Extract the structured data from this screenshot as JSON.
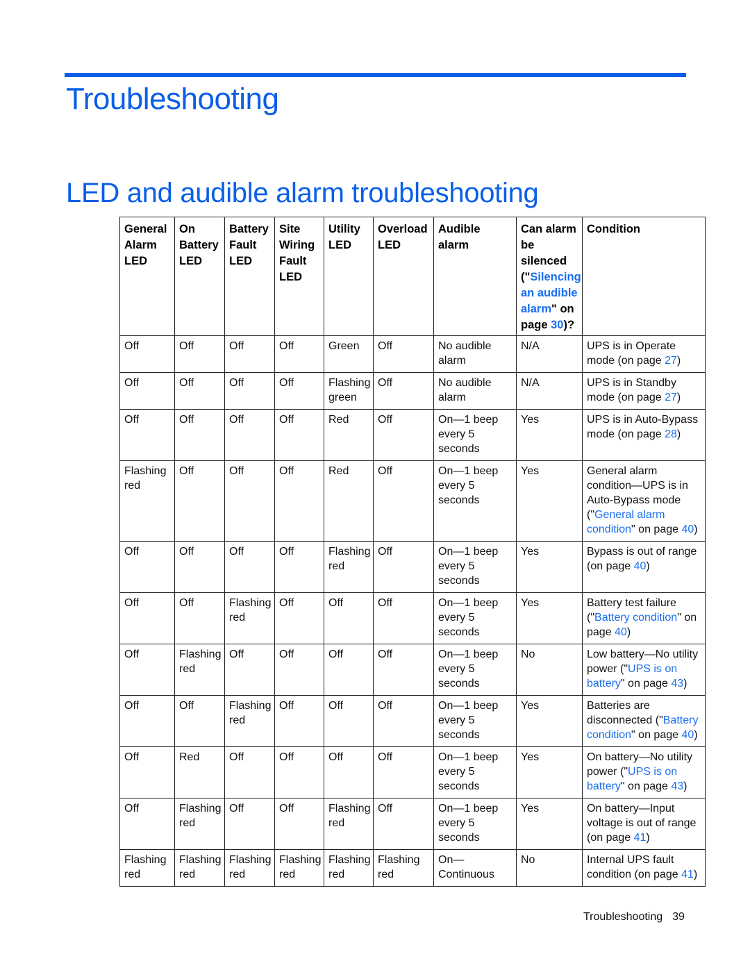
{
  "chapter_title": "Troubleshooting",
  "section_title": "LED and audible alarm troubleshooting",
  "table": {
    "headers": [
      {
        "parts": [
          {
            "text": "General Alarm LED"
          }
        ]
      },
      {
        "parts": [
          {
            "text": "On Battery LED"
          }
        ]
      },
      {
        "parts": [
          {
            "text": "Battery Fault LED"
          }
        ]
      },
      {
        "parts": [
          {
            "text": "Site Wiring Fault LED"
          }
        ]
      },
      {
        "parts": [
          {
            "text": "Utility LED"
          }
        ]
      },
      {
        "parts": [
          {
            "text": "Overload LED"
          }
        ]
      },
      {
        "parts": [
          {
            "text": "Audible alarm"
          }
        ]
      },
      {
        "parts": [
          {
            "text": "Can alarm be silenced (\""
          },
          {
            "text": "Silencing an audible alarm",
            "link": true
          },
          {
            "text": "\" on page "
          },
          {
            "text": "30",
            "link": true
          },
          {
            "text": ")?"
          }
        ]
      },
      {
        "parts": [
          {
            "text": "Condition"
          }
        ]
      }
    ],
    "rows": [
      {
        "cells": [
          "Off",
          "Off",
          "Off",
          "Off",
          "Green",
          "Off",
          "No audible alarm",
          "N/A"
        ],
        "condition": [
          {
            "text": "UPS is in Operate mode (on page "
          },
          {
            "text": "27",
            "link": true
          },
          {
            "text": ")"
          }
        ]
      },
      {
        "cells": [
          "Off",
          "Off",
          "Off",
          "Off",
          "Flashing green",
          "Off",
          "No audible alarm",
          "N/A"
        ],
        "condition": [
          {
            "text": "UPS is in Standby mode (on page "
          },
          {
            "text": "27",
            "link": true
          },
          {
            "text": ")"
          }
        ]
      },
      {
        "cells": [
          "Off",
          "Off",
          "Off",
          "Off",
          "Red",
          "Off",
          "On—1 beep every 5 seconds",
          "Yes"
        ],
        "condition": [
          {
            "text": "UPS is in Auto-Bypass mode (on page "
          },
          {
            "text": "28",
            "link": true
          },
          {
            "text": ")"
          }
        ]
      },
      {
        "cells": [
          "Flashing red",
          "Off",
          "Off",
          "Off",
          "Red",
          "Off",
          "On—1 beep every 5 seconds",
          "Yes"
        ],
        "condition": [
          {
            "text": "General alarm condition—UPS is in Auto-Bypass mode (\""
          },
          {
            "text": "General alarm condition",
            "link": true
          },
          {
            "text": "\" on page "
          },
          {
            "text": "40",
            "link": true
          },
          {
            "text": ")"
          }
        ]
      },
      {
        "cells": [
          "Off",
          "Off",
          "Off",
          "Off",
          "Flashing red",
          "Off",
          "On—1 beep every 5 seconds",
          "Yes"
        ],
        "condition": [
          {
            "text": "Bypass is out of range (on page "
          },
          {
            "text": "40",
            "link": true
          },
          {
            "text": ")"
          }
        ]
      },
      {
        "cells": [
          "Off",
          "Off",
          "Flashing red",
          "Off",
          "Off",
          "Off",
          "On—1 beep every 5 seconds",
          "Yes"
        ],
        "condition": [
          {
            "text": "Battery test failure (\""
          },
          {
            "text": "Battery condition",
            "link": true
          },
          {
            "text": "\" on page "
          },
          {
            "text": "40",
            "link": true
          },
          {
            "text": ")"
          }
        ]
      },
      {
        "cells": [
          "Off",
          "Flashing red",
          "Off",
          "Off",
          "Off",
          "Off",
          "On—1 beep every 5 seconds",
          "No"
        ],
        "condition": [
          {
            "text": "Low battery—No utility power (\""
          },
          {
            "text": "UPS is on battery",
            "link": true
          },
          {
            "text": "\" on page "
          },
          {
            "text": "43",
            "link": true
          },
          {
            "text": ")"
          }
        ]
      },
      {
        "cells": [
          "Off",
          "Off",
          "Flashing red",
          "Off",
          "Off",
          "Off",
          "On—1 beep every 5 seconds",
          "Yes"
        ],
        "condition": [
          {
            "text": "Batteries are disconnected (\""
          },
          {
            "text": "Battery condition",
            "link": true
          },
          {
            "text": "\" on page "
          },
          {
            "text": "40",
            "link": true
          },
          {
            "text": ")"
          }
        ]
      },
      {
        "cells": [
          "Off",
          "Red",
          "Off",
          "Off",
          "Off",
          "Off",
          "On—1 beep every 5 seconds",
          "Yes"
        ],
        "condition": [
          {
            "text": "On battery—No utility power (\""
          },
          {
            "text": "UPS is on battery",
            "link": true
          },
          {
            "text": "\" on page "
          },
          {
            "text": "43",
            "link": true
          },
          {
            "text": ")"
          }
        ]
      },
      {
        "cells": [
          "Off",
          "Flashing red",
          "Off",
          "Off",
          "Flashing red",
          "Off",
          "On—1 beep every 5 seconds",
          "Yes"
        ],
        "condition": [
          {
            "text": "On battery—Input voltage is out of range (on page "
          },
          {
            "text": "41",
            "link": true
          },
          {
            "text": ")"
          }
        ]
      },
      {
        "cells": [
          "Flashing red",
          "Flashing red",
          "Flashing red",
          "Flashing red",
          "Flashing red",
          "Flashing red",
          "On— Continuous",
          "No"
        ],
        "condition": [
          {
            "text": "Internal UPS fault condition (on page "
          },
          {
            "text": "41",
            "link": true
          },
          {
            "text": ")"
          }
        ]
      }
    ]
  },
  "footer": {
    "section": "Troubleshooting",
    "page_number": "39"
  },
  "colors": {
    "accent": "#0a5fe8",
    "link": "#1a6ef0"
  }
}
